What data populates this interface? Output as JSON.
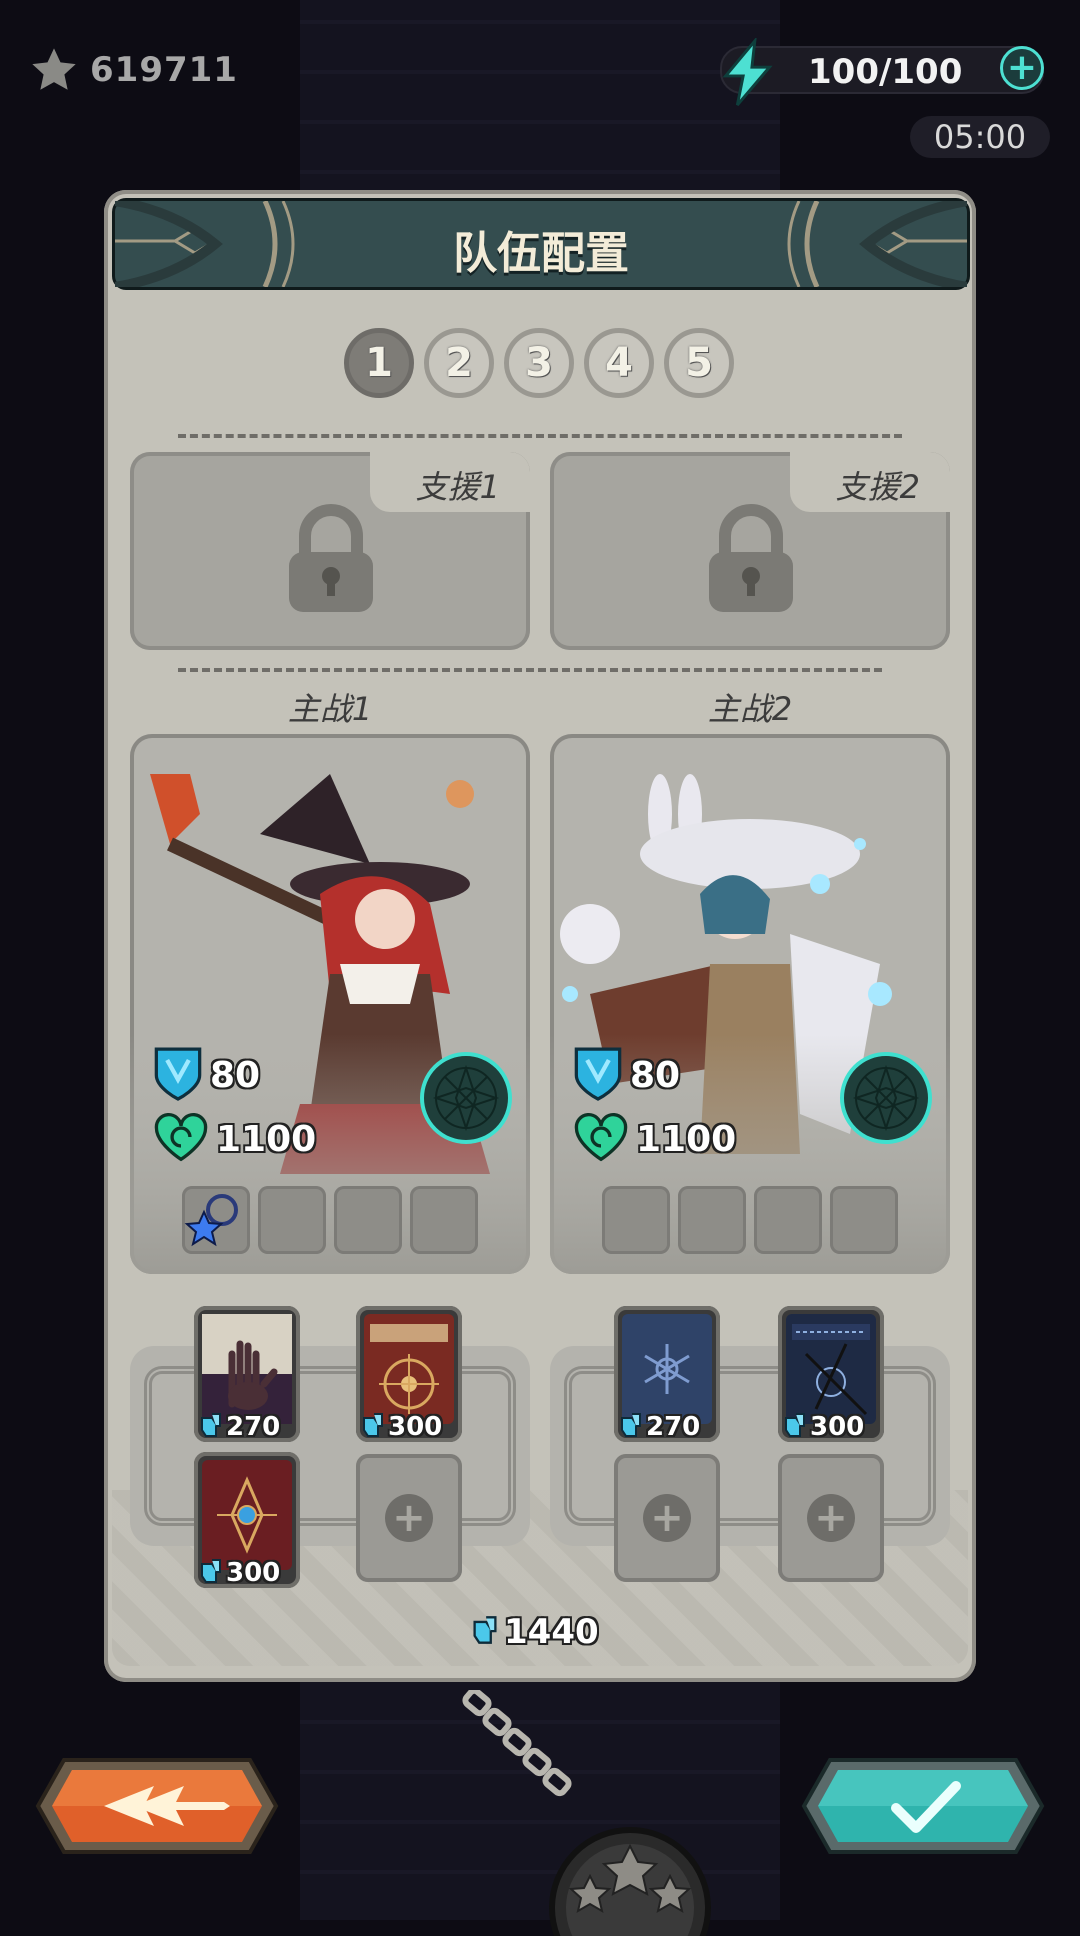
{
  "top_bar": {
    "stars_value": "619711",
    "energy_value": "100/100",
    "energy_add_icon": "plus-icon",
    "timer": "05:00"
  },
  "panel": {
    "title": "队伍配置",
    "team_tabs": [
      "1",
      "2",
      "3",
      "4",
      "5"
    ],
    "active_team": "1",
    "supports": [
      {
        "label": "支援1",
        "locked": true
      },
      {
        "label": "支援2",
        "locked": true
      }
    ],
    "main_fighters": [
      {
        "label": "主战1",
        "character": "red-haired-witch",
        "defense": "80",
        "hp": "1100",
        "equipped_items": 1,
        "item_slots": 4
      },
      {
        "label": "主战2",
        "character": "bunny-scholar",
        "defense": "80",
        "hp": "1100",
        "equipped_items": 0,
        "item_slots": 4
      }
    ],
    "books_left": [
      {
        "cover": "dark-hand-tome",
        "cost": "270"
      },
      {
        "cover": "red-rune-tome",
        "cost": "300"
      },
      {
        "cover": "crimson-gem-tome",
        "cost": "300"
      }
    ],
    "books_right": [
      {
        "cover": "blue-snowflake-tome",
        "cost": "270"
      },
      {
        "cover": "dark-rune-chained-tome",
        "cost": "300"
      }
    ],
    "total_cost": "1440"
  },
  "buttons": {
    "back_icon": "back-arrows-icon",
    "confirm_icon": "checkmark-icon"
  },
  "colors": {
    "accent_teal": "#4de0d2",
    "back_button": "#e0602a",
    "confirm_button": "#2fb4ad",
    "panel": "#c4c2b9"
  }
}
